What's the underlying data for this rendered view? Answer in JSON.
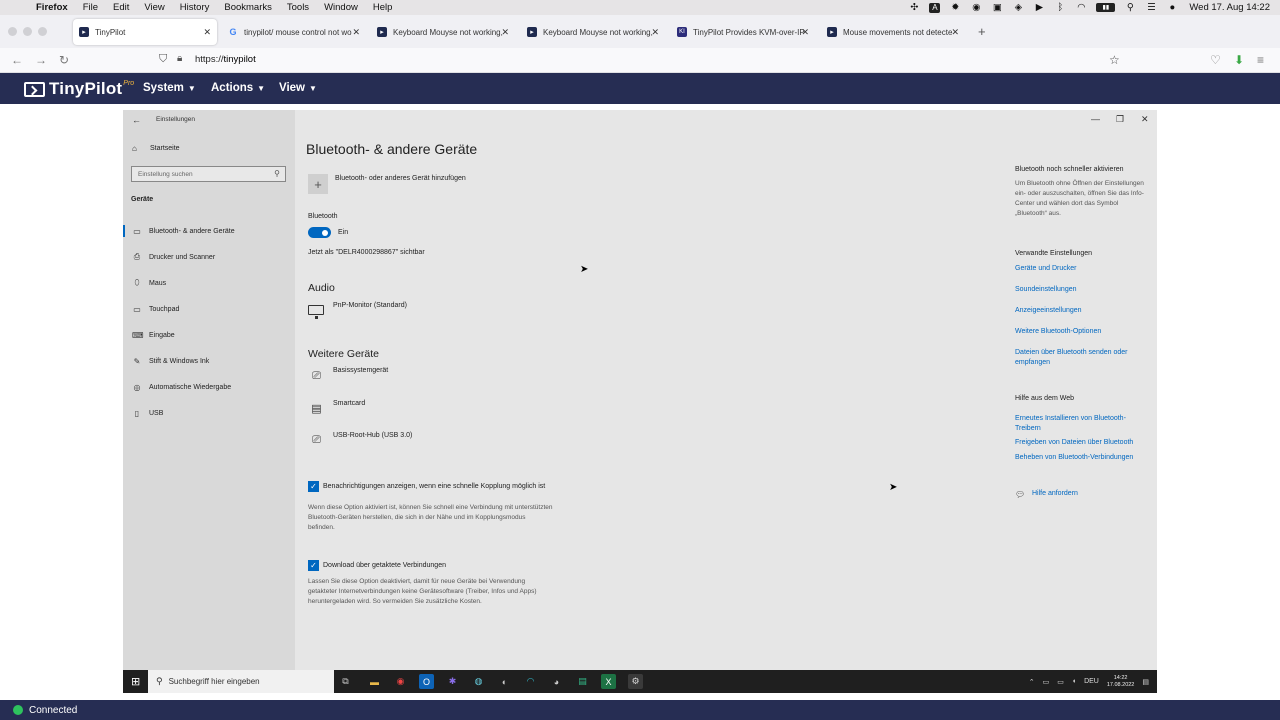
{
  "mac_menubar": {
    "app": "Firefox",
    "items": [
      "File",
      "Edit",
      "View",
      "History",
      "Bookmarks",
      "Tools",
      "Window",
      "Help"
    ],
    "clock": "Wed 17. Aug  14:22"
  },
  "browser": {
    "tabs": [
      {
        "label": "TinyPilot",
        "favicon": "tinypilot-icon"
      },
      {
        "label": "tinypilot/ mouse control not wo",
        "favicon": "google-icon"
      },
      {
        "label": "Keyboard Mouyse not working, (",
        "favicon": "tinypilot-icon"
      },
      {
        "label": "Keyboard Mouyse not working, (",
        "favicon": "tinypilot-icon"
      },
      {
        "label": "TinyPilot Provides KVM-over-IP",
        "favicon": "kvm-icon"
      },
      {
        "label": "Mouse movements not detecte",
        "favicon": "tinypilot-icon"
      }
    ],
    "url_prefix": "https://",
    "url_host": "tinypilot"
  },
  "tinypilot": {
    "brand": "TinyPilot",
    "brand_badge": "Pro",
    "menu": [
      "System",
      "Actions",
      "View"
    ],
    "status": "Connected"
  },
  "settings": {
    "window_title": "Einstellungen",
    "home": "Startseite",
    "search_placeholder": "Einstellung suchen",
    "section": "Geräte",
    "nav": [
      "Bluetooth- & andere Geräte",
      "Drucker und Scanner",
      "Maus",
      "Touchpad",
      "Eingabe",
      "Stift & Windows Ink",
      "Automatische Wiedergabe",
      "USB"
    ],
    "page_title": "Bluetooth- & andere Geräte",
    "add_device": "Bluetooth- oder anderes Gerät hinzufügen",
    "bluetooth_label": "Bluetooth",
    "bluetooth_state": "Ein",
    "visible_as": "Jetzt als \"DELR4000298867\" sichtbar",
    "audio_heading": "Audio",
    "audio_devices": [
      "PnP-Monitor (Standard)"
    ],
    "other_heading": "Weitere Geräte",
    "other_devices": [
      "Basissystemgerät",
      "Smartcard",
      "USB-Root-Hub (USB 3.0)"
    ],
    "notify_label": "Benachrichtigungen anzeigen, wenn eine schnelle Kopplung möglich ist",
    "notify_desc": "Wenn diese Option aktiviert ist, können Sie schnell eine Verbindung mit unterstützten Bluetooth-Geräten herstellen, die sich in der Nähe und im Kopplungsmodus befinden.",
    "download_label": "Download über getaktete Verbindungen",
    "download_desc": "Lassen Sie diese Option deaktiviert, damit für neue Geräte bei Verwendung getakteter Internetverbindungen keine Gerätesoftware (Treiber, Infos und Apps) heruntergeladen wird. So vermeiden Sie zusätzliche Kosten.",
    "right": {
      "quick_heading": "Bluetooth noch schneller aktivieren",
      "quick_text": "Um Bluetooth ohne Öffnen der Einstellungen ein- oder auszuschalten, öffnen Sie das Info-Center und wählen dort das Symbol „Bluetooth“ aus.",
      "related_heading": "Verwandte Einstellungen",
      "related_links": [
        "Geräte und Drucker",
        "Soundeinstellungen",
        "Anzeigeeinstellungen",
        "Weitere Bluetooth-Optionen",
        "Dateien über Bluetooth senden oder empfangen"
      ],
      "web_heading": "Hilfe aus dem Web",
      "web_links": [
        "Erneutes Installieren von Bluetooth-Treibern",
        "Freigeben von Dateien über Bluetooth",
        "Beheben von Bluetooth-Verbindungen"
      ],
      "help_link": "Hilfe anfordern"
    }
  },
  "taskbar": {
    "search_placeholder": "Suchbegriff hier eingeben",
    "language": "DEU",
    "time": "14:22",
    "date": "17.08.2022"
  },
  "colors": {
    "tinypilot_navy": "#262d53",
    "windows_accent": "#0067c0",
    "connected_green": "#2ec35e"
  }
}
